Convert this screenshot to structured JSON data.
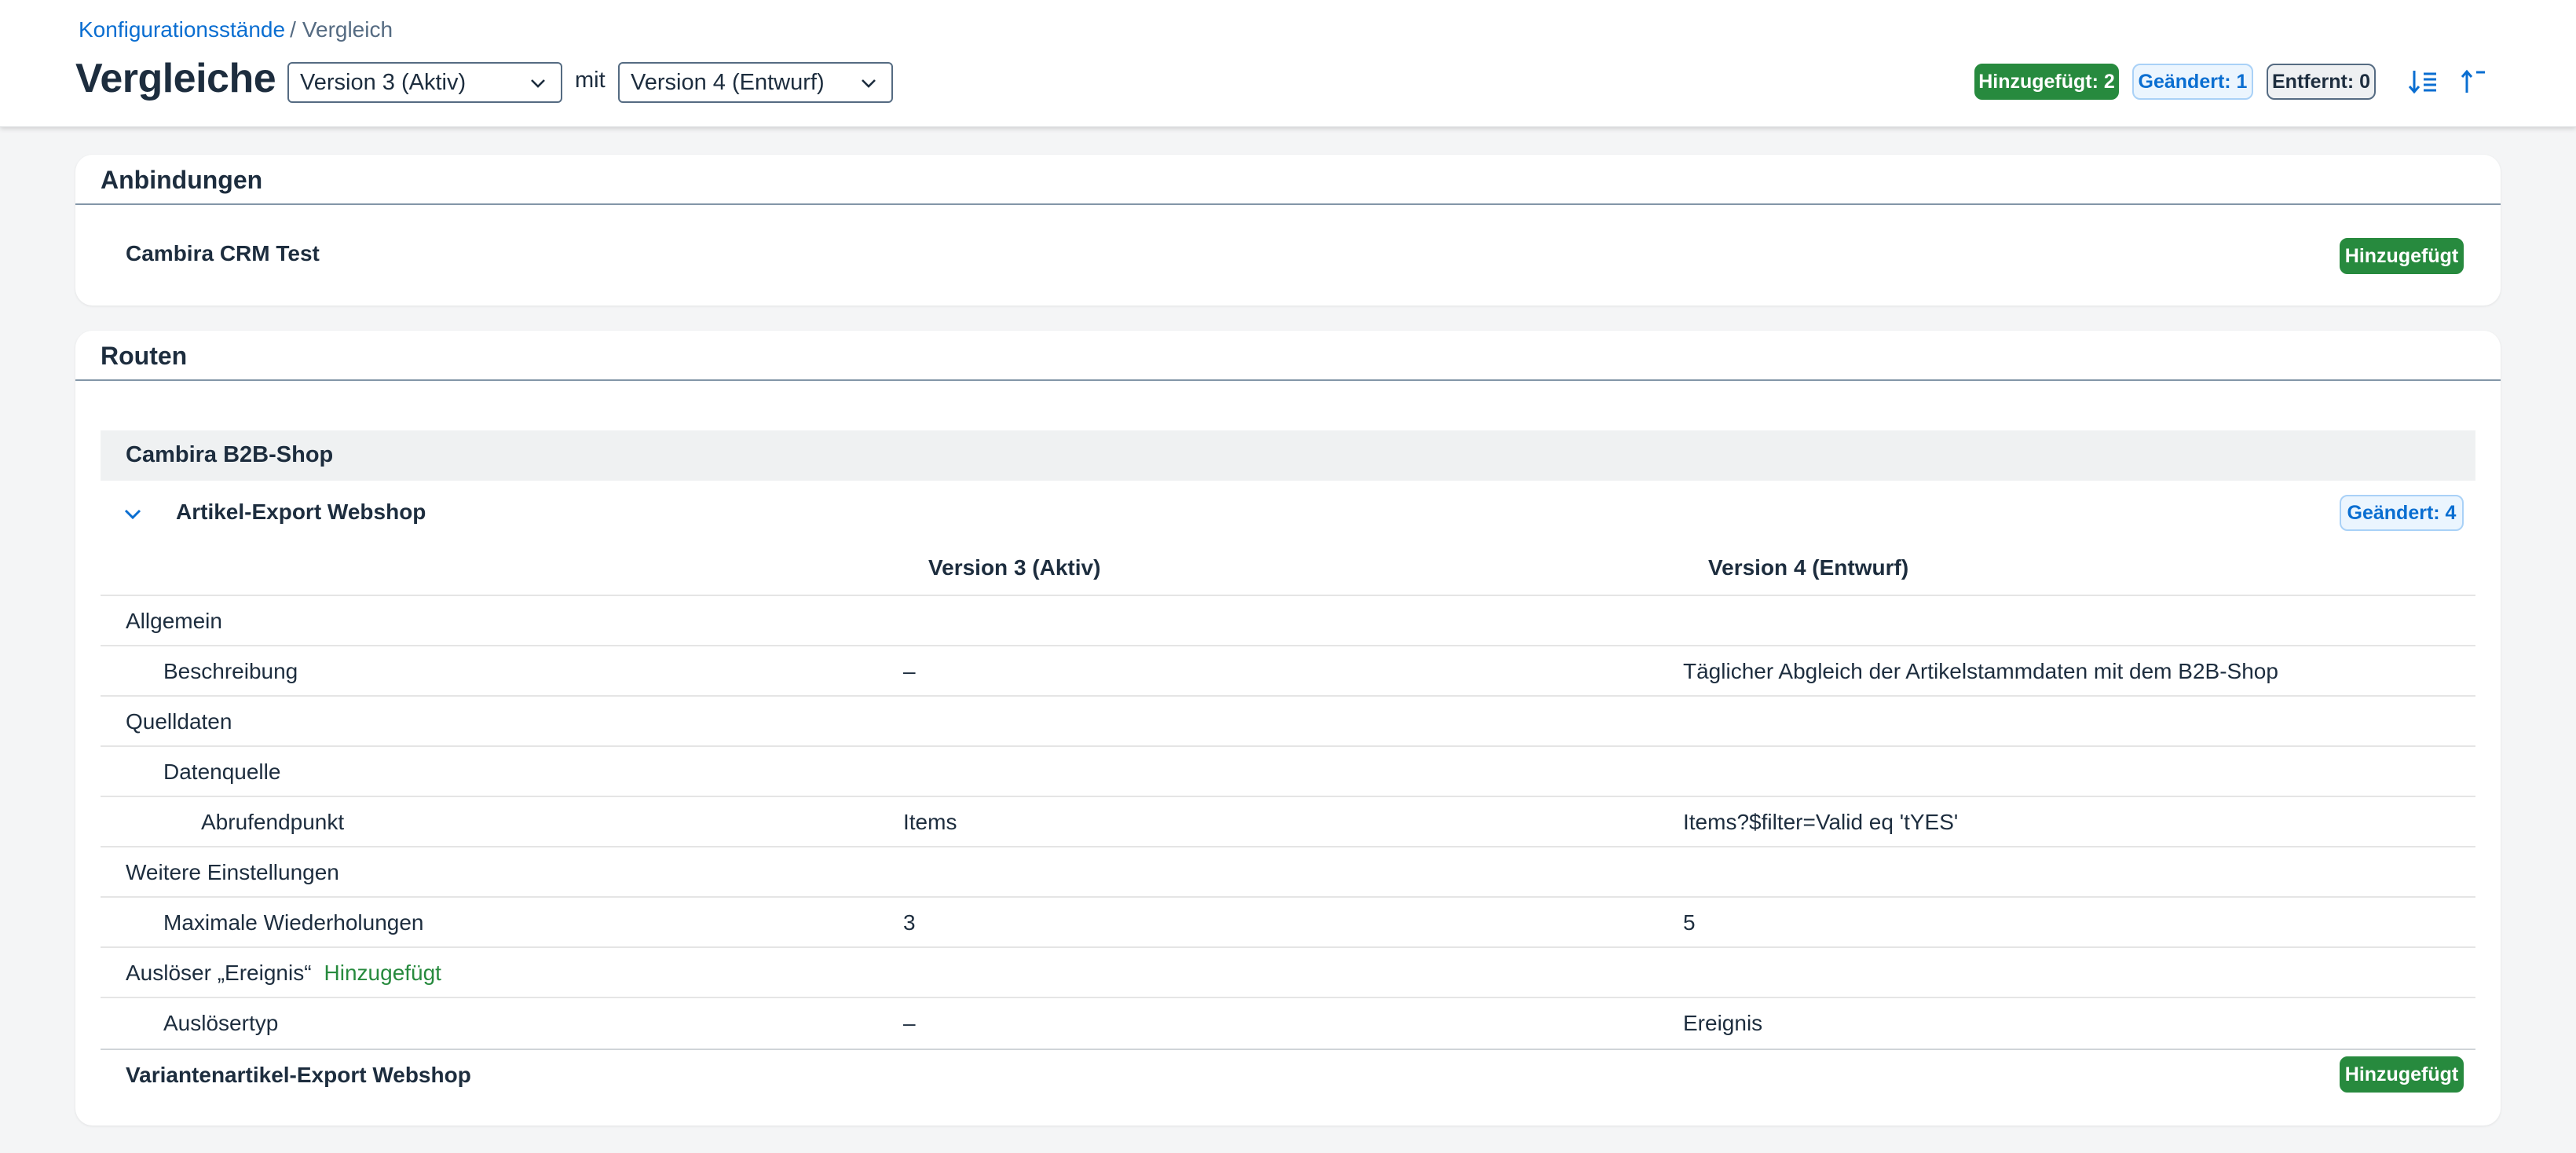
{
  "breadcrumb": {
    "parent": "Konfigurationsstände",
    "separator": "/",
    "current": "Vergleich"
  },
  "title": "Vergleiche",
  "compare": {
    "left_version": "Version 3 (Aktiv)",
    "joiner": "mit",
    "right_version": "Version 4 (Entwurf)"
  },
  "summary": {
    "added": "Hinzugefügt: 2",
    "changed": "Geändert: 1",
    "removed": "Entfernt: 0"
  },
  "toolbar": {
    "sort_icon": "sort-ascending-icon",
    "collapse_icon": "collapse-all-icon"
  },
  "colors": {
    "accent": "#0a6ed1",
    "added": "#278a3e",
    "text": "#1d2d3e",
    "background": "#f4f5f6"
  },
  "sections": {
    "anbindungen": {
      "title": "Anbindungen",
      "items": [
        {
          "name": "Cambira CRM Test",
          "status": "Hinzugefügt"
        }
      ]
    },
    "routen": {
      "title": "Routen",
      "group": "Cambira B2B-Shop",
      "route": {
        "name": "Artikel-Export Webshop",
        "status": "Geändert: 4",
        "columns": [
          "Version 3 (Aktiv)",
          "Version 4 (Entwurf)"
        ],
        "rows": [
          {
            "label": "Allgemein",
            "left": "",
            "right": ""
          },
          {
            "label": "Beschreibung",
            "left": "–",
            "right": "Täglicher Abgleich der Artikelstammdaten mit dem B2B-Shop"
          },
          {
            "label": "Quelldaten",
            "left": "",
            "right": ""
          },
          {
            "label": "Datenquelle",
            "left": "",
            "right": ""
          },
          {
            "label": "Abrufendpunkt",
            "left": "Items",
            "right": "Items?$filter=Valid eq 'tYES'"
          },
          {
            "label": "Weitere Einstellungen",
            "left": "",
            "right": ""
          },
          {
            "label": "Maximale Wiederholungen",
            "left": "3",
            "right": "5"
          },
          {
            "label": "Auslöser „Ereignis“",
            "tag": "Hinzugefügt",
            "left": "",
            "right": ""
          },
          {
            "label": "Auslösertyp",
            "left": "–",
            "right": "Ereignis"
          }
        ]
      },
      "other_route": {
        "name": "Variantenartikel-Export Webshop",
        "status": "Hinzugefügt"
      }
    }
  }
}
